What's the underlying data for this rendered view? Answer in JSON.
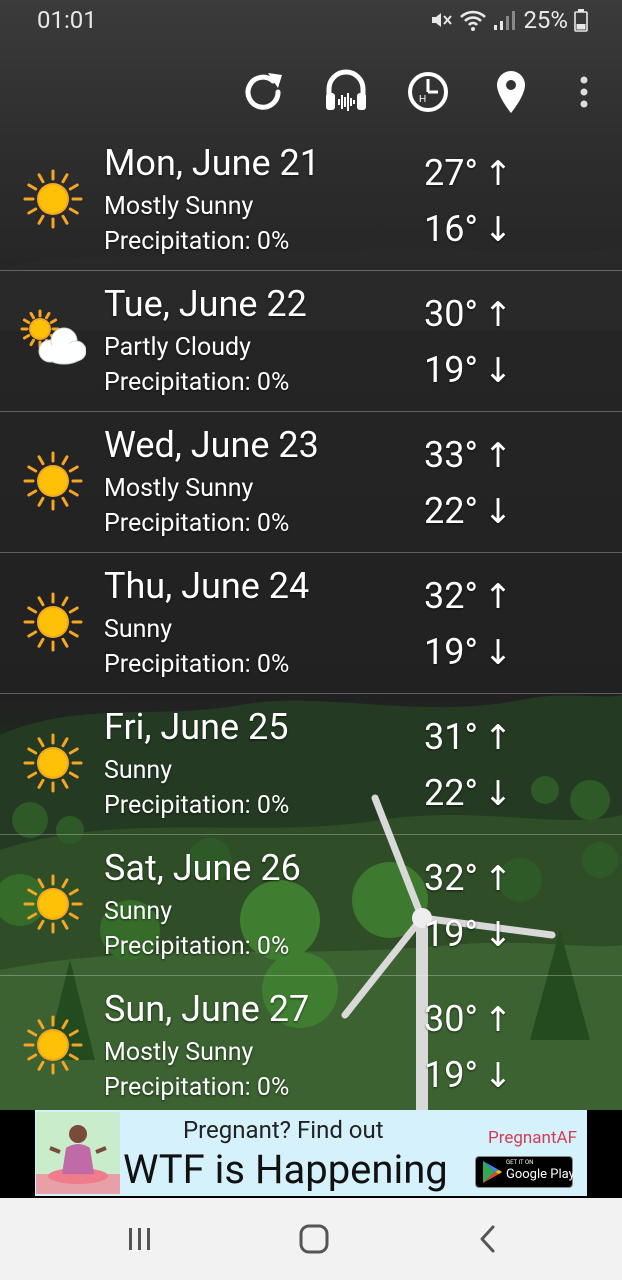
{
  "status": {
    "time": "01:01",
    "battery": "25%"
  },
  "toolbar": {
    "icons": [
      "refresh-icon",
      "headphones-icon",
      "hourly-clock-icon",
      "location-pin-icon",
      "more-vert-icon"
    ]
  },
  "forecast": [
    {
      "day": "Mon, June 21",
      "condition": "Mostly Sunny",
      "precip": "Precipitation: 0%",
      "high": "27°",
      "low": "16°",
      "icon": "sun-icon"
    },
    {
      "day": "Tue, June 22",
      "condition": "Partly Cloudy",
      "precip": "Precipitation: 0%",
      "high": "30°",
      "low": "19°",
      "icon": "partly-cloudy-icon"
    },
    {
      "day": "Wed, June 23",
      "condition": "Mostly Sunny",
      "precip": "Precipitation: 0%",
      "high": "33°",
      "low": "22°",
      "icon": "sun-icon"
    },
    {
      "day": "Thu, June 24",
      "condition": "Sunny",
      "precip": "Precipitation: 0%",
      "high": "32°",
      "low": "19°",
      "icon": "sun-icon"
    },
    {
      "day": "Fri, June 25",
      "condition": "Sunny",
      "precip": "Precipitation: 0%",
      "high": "31°",
      "low": "22°",
      "icon": "sun-icon"
    },
    {
      "day": "Sat, June 26",
      "condition": "Sunny",
      "precip": "Precipitation: 0%",
      "high": "32°",
      "low": "19°",
      "icon": "sun-icon"
    },
    {
      "day": "Sun, June 27",
      "condition": "Mostly Sunny",
      "precip": "Precipitation: 0%",
      "high": "30°",
      "low": "19°",
      "icon": "sun-icon"
    }
  ],
  "arrows": {
    "up": "↑",
    "down": "↓"
  },
  "ad": {
    "line1": "Pregnant? Find out",
    "line2": "WTF is Happening",
    "brand": "PregnantAF",
    "store_small": "GET IT ON",
    "store": "Google Play"
  },
  "colors": {
    "sun": "#FFC107",
    "sun_rays": "#F5A623",
    "brand": "#d23c56"
  }
}
